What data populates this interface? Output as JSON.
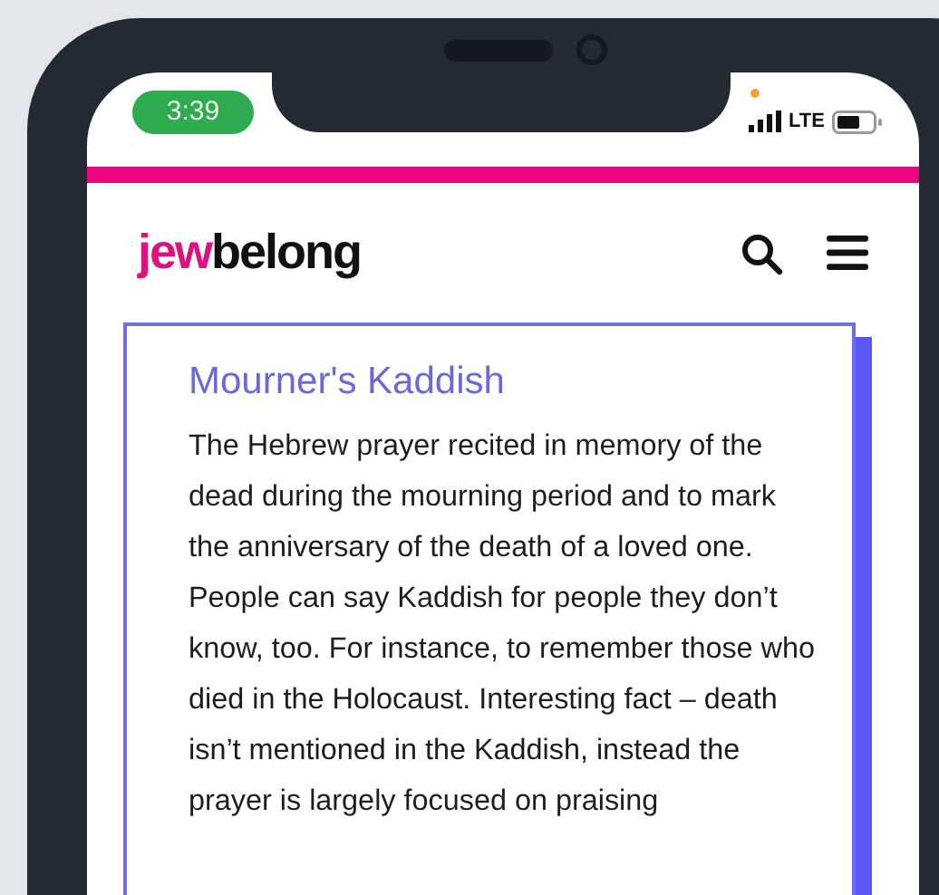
{
  "status_bar": {
    "time": "3:39",
    "network": "LTE"
  },
  "header": {
    "logo": {
      "accent": "jew",
      "rest": "belong"
    }
  },
  "article": {
    "title": "Mourner's Kaddish",
    "body": "The Hebrew prayer recited in memory of the dead during the mourning period and to mark the anniversary of the death of a loved one. People can say Kaddish for people they don’t know, too. For instance, to remember those who died in the Holocaust. Interesting fact – death isn’t mentioned in the Kaddish, instead the prayer is largely focused on praising"
  }
}
